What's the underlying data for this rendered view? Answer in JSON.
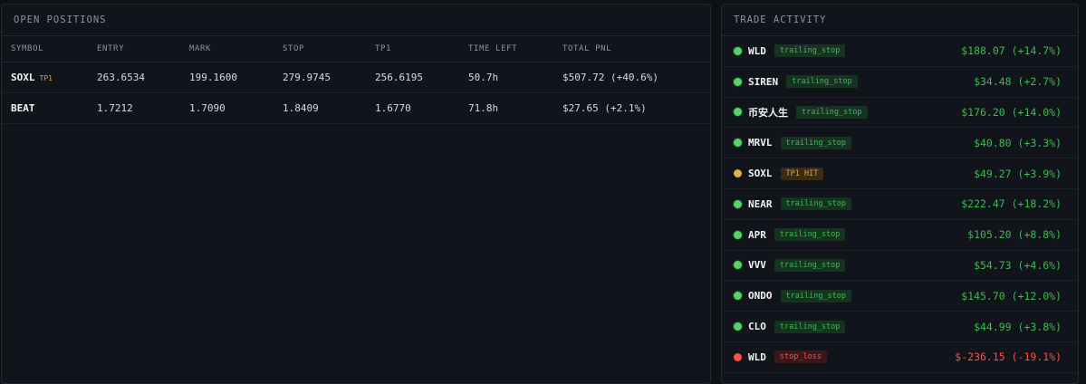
{
  "positions": {
    "title": "OPEN POSITIONS",
    "columns": [
      "SYMBOL",
      "ENTRY",
      "MARK",
      "STOP",
      "TP1",
      "TIME LEFT",
      "TOTAL PNL"
    ],
    "rows": [
      {
        "symbol": "SOXL",
        "tag": "TP1",
        "entry": "263.6534",
        "mark": "199.1600",
        "stop": "279.9745",
        "tp1": "256.6195",
        "time_left": "50.7h",
        "pnl": "$507.72 (+40.6%)"
      },
      {
        "symbol": "BEAT",
        "tag": "",
        "entry": "1.7212",
        "mark": "1.7090",
        "stop": "1.8409",
        "tp1": "1.6770",
        "time_left": "71.8h",
        "pnl": "$27.65 (+2.1%)"
      }
    ]
  },
  "activity": {
    "title": "TRADE ACTIVITY",
    "items": [
      {
        "symbol": "WLD",
        "status": "trailing_stop",
        "dot": "green",
        "pnl": "$188.07 (+14.7%)",
        "sign": "pos"
      },
      {
        "symbol": "SIREN",
        "status": "trailing_stop",
        "dot": "green",
        "pnl": "$34.48 (+2.7%)",
        "sign": "pos"
      },
      {
        "symbol": "币安人生",
        "status": "trailing_stop",
        "dot": "green",
        "pnl": "$176.20 (+14.0%)",
        "sign": "pos"
      },
      {
        "symbol": "MRVL",
        "status": "trailing_stop",
        "dot": "green",
        "pnl": "$40.80 (+3.3%)",
        "sign": "pos"
      },
      {
        "symbol": "SOXL",
        "status": "TP1 HIT",
        "dot": "yellow",
        "pnl": "$49.27 (+3.9%)",
        "sign": "pos"
      },
      {
        "symbol": "NEAR",
        "status": "trailing_stop",
        "dot": "green",
        "pnl": "$222.47 (+18.2%)",
        "sign": "pos"
      },
      {
        "symbol": "APR",
        "status": "trailing_stop",
        "dot": "green",
        "pnl": "$105.20 (+8.8%)",
        "sign": "pos"
      },
      {
        "symbol": "VVV",
        "status": "trailing_stop",
        "dot": "green",
        "pnl": "$54.73 (+4.6%)",
        "sign": "pos"
      },
      {
        "symbol": "ONDO",
        "status": "trailing_stop",
        "dot": "green",
        "pnl": "$145.70 (+12.0%)",
        "sign": "pos"
      },
      {
        "symbol": "CLO",
        "status": "trailing_stop",
        "dot": "green",
        "pnl": "$44.99 (+3.8%)",
        "sign": "pos"
      },
      {
        "symbol": "WLD",
        "status": "stop_loss",
        "dot": "red",
        "pnl": "$-236.15 (-19.1%)",
        "sign": "neg"
      }
    ]
  },
  "colors": {
    "background": "#0d1014",
    "panel": "#11151b",
    "positive": "#3fb950",
    "negative": "#f85149",
    "warning": "#d9a441"
  }
}
